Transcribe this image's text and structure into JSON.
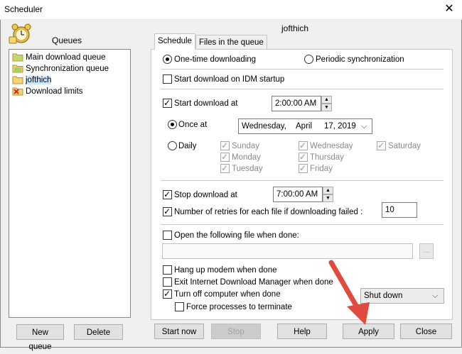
{
  "window": {
    "title": "Scheduler",
    "close_glyph": "✕"
  },
  "queues": {
    "header": "Queues",
    "items": [
      {
        "label": "Main download queue",
        "icon": "queue-folder-icon"
      },
      {
        "label": "Synchronization queue",
        "icon": "sync-folder-icon"
      },
      {
        "label": "jofthich",
        "icon": "queue-folder-icon",
        "selected": true
      },
      {
        "label": "Download limits",
        "icon": "download-limits-icon"
      }
    ],
    "new_queue_label": "New queue",
    "delete_label": "Delete"
  },
  "queue_name": "jofthich",
  "tabs": [
    {
      "label": "Schedule",
      "active": true
    },
    {
      "label": "Files in the queue",
      "active": false
    }
  ],
  "schedule": {
    "one_time_label": "One-time downloading",
    "one_time_selected": true,
    "periodic_label": "Periodic synchronization",
    "periodic_selected": false,
    "idm_startup_label": "Start download on IDM startup",
    "idm_startup_checked": false,
    "start_at_label": "Start download at",
    "start_at_checked": true,
    "start_time": "2:00:00 AM",
    "once_at_label": "Once at",
    "once_at_selected": true,
    "date_weekday": "Wednesday,",
    "date_month": "April",
    "date_day_year": "17, 2019",
    "daily_label": "Daily",
    "daily_selected": false,
    "days": {
      "sunday": "Sunday",
      "monday": "Monday",
      "tuesday": "Tuesday",
      "wednesday": "Wednesday",
      "thursday": "Thursday",
      "friday": "Friday",
      "saturday": "Saturday"
    },
    "stop_at_label": "Stop download at",
    "stop_at_checked": true,
    "stop_time": "7:00:00 AM",
    "retries_label": "Number of retries for each file if downloading failed :",
    "retries_checked": true,
    "retries_value": "10",
    "open_file_label": "Open the following file when done:",
    "open_file_checked": false,
    "open_file_path": "",
    "browse_label": "...",
    "hangup_label": "Hang up modem when done",
    "exit_idm_label": "Exit Internet Download Manager when done",
    "turn_off_label": "Turn off computer when done",
    "turn_off_checked": true,
    "shutdown_option": "Shut down",
    "force_label": "Force processes to terminate"
  },
  "buttons": {
    "start_now": "Start now",
    "stop": "Stop",
    "help": "Help",
    "apply": "Apply",
    "close": "Close"
  },
  "colors": {
    "selection": "#cce8ff",
    "annotation_arrow": "#e04a3f"
  }
}
